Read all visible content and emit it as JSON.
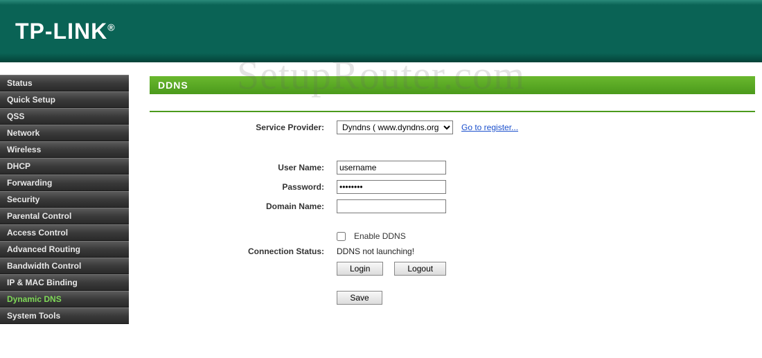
{
  "brand": "TP-LINK",
  "watermark": "SetupRouter.com",
  "sidebar": {
    "items": [
      {
        "label": "Status"
      },
      {
        "label": "Quick Setup"
      },
      {
        "label": "QSS"
      },
      {
        "label": "Network"
      },
      {
        "label": "Wireless"
      },
      {
        "label": "DHCP"
      },
      {
        "label": "Forwarding"
      },
      {
        "label": "Security"
      },
      {
        "label": "Parental Control"
      },
      {
        "label": "Access Control"
      },
      {
        "label": "Advanced Routing"
      },
      {
        "label": "Bandwidth Control"
      },
      {
        "label": "IP & MAC Binding"
      },
      {
        "label": "Dynamic DNS"
      },
      {
        "label": "System Tools"
      }
    ]
  },
  "page": {
    "title": "DDNS",
    "labels": {
      "service_provider": "Service Provider:",
      "user_name": "User Name:",
      "password": "Password:",
      "domain_name": "Domain Name:",
      "enable_ddns": "Enable DDNS",
      "connection_status": "Connection Status:"
    },
    "values": {
      "provider_selected": "Dyndns ( www.dyndns.org )",
      "user_name": "username",
      "password": "••••••••",
      "domain_name": "",
      "enable_ddns_checked": false,
      "connection_status": "DDNS not launching!"
    },
    "links": {
      "register": "Go to register..."
    },
    "buttons": {
      "login": "Login",
      "logout": "Logout",
      "save": "Save"
    }
  }
}
